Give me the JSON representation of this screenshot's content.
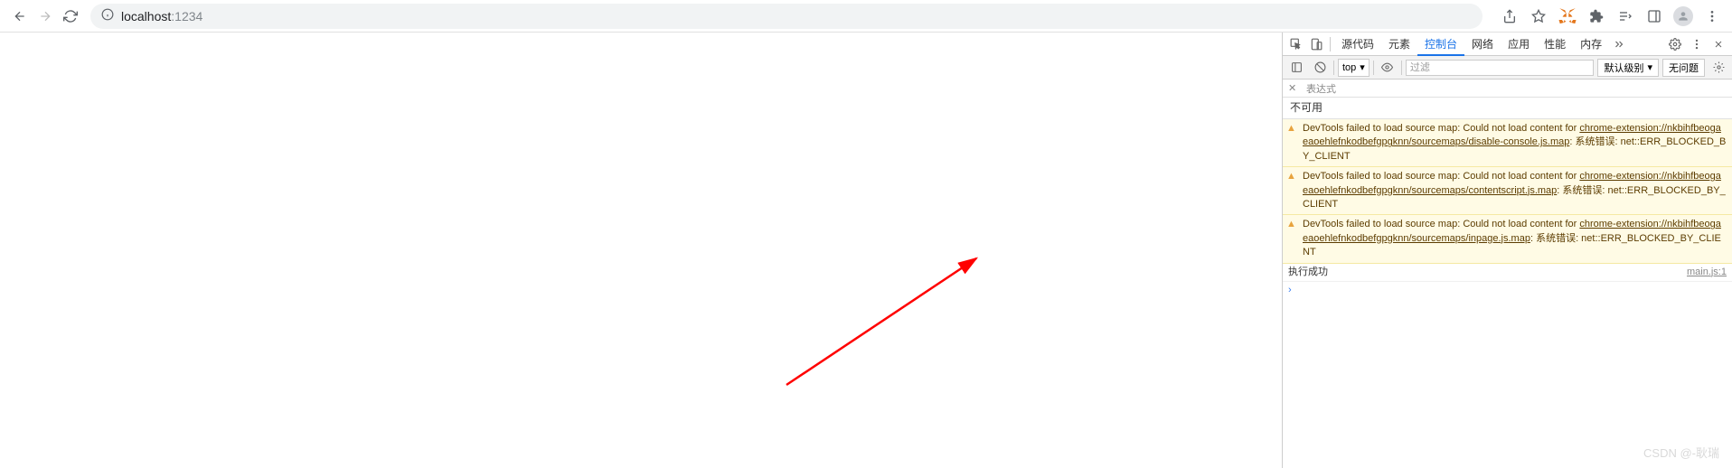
{
  "browser": {
    "url_host": "localhost",
    "url_port": ":1234"
  },
  "devtools": {
    "tabs": {
      "sources": "源代码",
      "elements": "元素",
      "console": "控制台",
      "network": "网络",
      "application": "应用",
      "performance": "性能",
      "memory": "内存"
    },
    "filter": {
      "context": "top",
      "placeholder": "过滤",
      "level": "默认级别",
      "issues": "无问题"
    },
    "expression_label": "表达式",
    "not_available": "不可用",
    "warnings": [
      {
        "prefix": "DevTools failed to load source map: Could not load content for ",
        "url": "chrome-extension://nkbihfbeogaeaoehlefnkodbefgpgknn/sourcemaps/disable-console.js.map",
        "suffix": ": 系统错误: net::ERR_BLOCKED_BY_CLIENT"
      },
      {
        "prefix": "DevTools failed to load source map: Could not load content for ",
        "url": "chrome-extension://nkbihfbeogaeaoehlefnkodbefgpgknn/sourcemaps/contentscript.js.map",
        "suffix": ": 系统错误: net::ERR_BLOCKED_BY_CLIENT"
      },
      {
        "prefix": "DevTools failed to load source map: Could not load content for ",
        "url": "chrome-extension://nkbihfbeogaeaoehlefnkodbefgpgknn/sourcemaps/inpage.js.map",
        "suffix": ": 系统错误: net::ERR_BLOCKED_BY_CLIENT"
      }
    ],
    "log": {
      "message": "执行成功",
      "source": "main.js:1"
    }
  },
  "watermark": "CSDN @-耿瑞"
}
